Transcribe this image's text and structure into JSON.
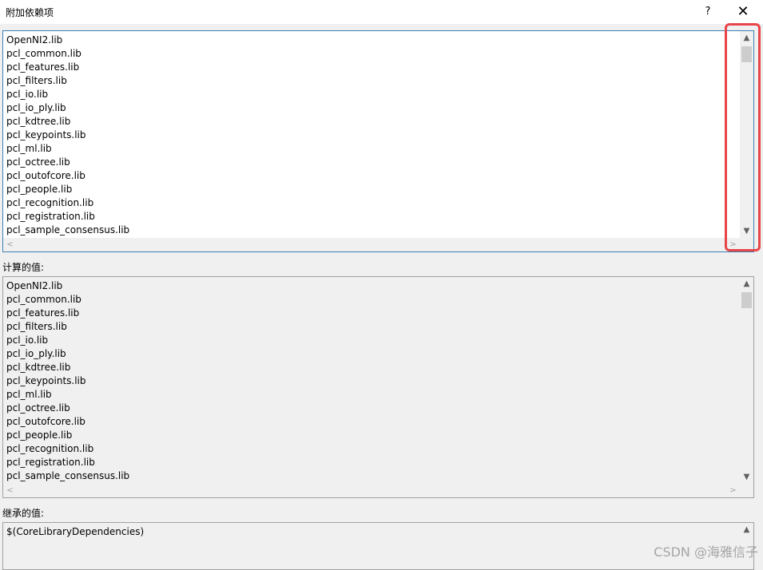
{
  "window": {
    "title": "附加依赖项",
    "help_label": "?",
    "close_label": "✕"
  },
  "editor": {
    "lines": [
      "OpenNI2.lib",
      "pcl_common.lib",
      "pcl_features.lib",
      "pcl_filters.lib",
      "pcl_io.lib",
      "pcl_io_ply.lib",
      "pcl_kdtree.lib",
      "pcl_keypoints.lib",
      "pcl_ml.lib",
      "pcl_octree.lib",
      "pcl_outofcore.lib",
      "pcl_people.lib",
      "pcl_recognition.lib",
      "pcl_registration.lib",
      "pcl_sample_consensus.lib"
    ]
  },
  "computed": {
    "label": "计算的值:",
    "lines": [
      "OpenNI2.lib",
      "pcl_common.lib",
      "pcl_features.lib",
      "pcl_filters.lib",
      "pcl_io.lib",
      "pcl_io_ply.lib",
      "pcl_kdtree.lib",
      "pcl_keypoints.lib",
      "pcl_ml.lib",
      "pcl_octree.lib",
      "pcl_outofcore.lib",
      "pcl_people.lib",
      "pcl_recognition.lib",
      "pcl_registration.lib",
      "pcl_sample_consensus.lib"
    ]
  },
  "inherited": {
    "label": "继承的值:",
    "lines": [
      "$(CoreLibraryDependencies)"
    ]
  },
  "scroll": {
    "up_icon": "chevron-up-icon",
    "down_icon": "chevron-down-icon",
    "left_icon": "chevron-left-icon",
    "right_icon": "chevron-right-icon",
    "up_glyph": "▲",
    "down_glyph": "▼",
    "left_glyph": "<",
    "right_glyph": ">"
  },
  "highlight_color": "#e8454a",
  "watermark": "CSDN @海雅信子"
}
